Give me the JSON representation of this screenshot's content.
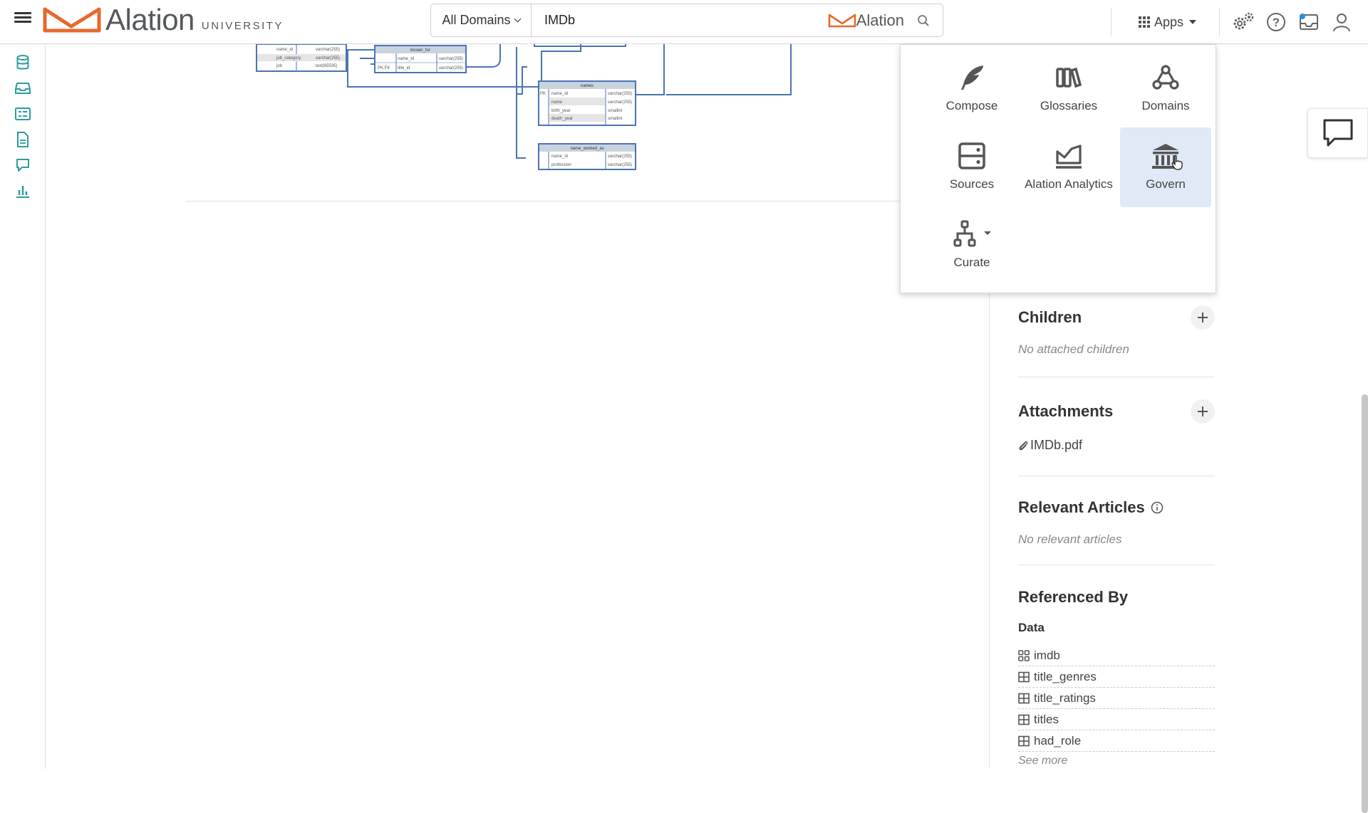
{
  "header": {
    "logo_text": "Alation",
    "logo_sub": "UNIVERSITY",
    "search_domain": "All Domains",
    "search_value": "IMDb",
    "search_brand": "Alation",
    "apps_label": "Apps"
  },
  "apps_menu": {
    "items": [
      {
        "label": "Compose",
        "icon": "quill-icon"
      },
      {
        "label": "Glossaries",
        "icon": "books-icon"
      },
      {
        "label": "Domains",
        "icon": "domains-icon"
      },
      {
        "label": "Sources",
        "icon": "server-icon"
      },
      {
        "label": "Alation Analytics",
        "icon": "analytics-icon"
      },
      {
        "label": "Govern",
        "icon": "bank-icon"
      },
      {
        "label": "Curate",
        "icon": "hierarchy-icon"
      }
    ],
    "active": "Govern"
  },
  "diagram": {
    "tables": [
      {
        "title": "",
        "rows": [
          [
            "",
            "name_id",
            "varchar(255)"
          ],
          [
            "",
            "job_category",
            "varchar(255)"
          ],
          [
            "",
            "job",
            "text(65535)"
          ]
        ]
      },
      {
        "title": "known_for",
        "rows": [
          [
            "",
            "name_id",
            "varchar(255)"
          ],
          [
            "PK,FK",
            "title_id",
            "varchar(255)"
          ]
        ]
      },
      {
        "title": "names",
        "rows": [
          [
            "PK",
            "name_id",
            "varchar(255)"
          ],
          [
            "",
            "name",
            "varchar(255)"
          ],
          [
            "",
            "birth_year",
            "smallint"
          ],
          [
            "",
            "death_year",
            "smallint"
          ]
        ]
      },
      {
        "title": "name_worked_as",
        "rows": [
          [
            "",
            "name_id",
            "varchar(255)"
          ],
          [
            "",
            "profession",
            "varchar(255)"
          ]
        ]
      }
    ]
  },
  "right_panel": {
    "children": {
      "title": "Children",
      "empty": "No attached children"
    },
    "attachments": {
      "title": "Attachments",
      "file": "IMDb.pdf"
    },
    "relevant": {
      "title": "Relevant Articles",
      "empty": "No relevant articles"
    },
    "referenced": {
      "title": "Referenced By",
      "subtitle": "Data",
      "items": [
        "imdb",
        "title_genres",
        "title_ratings",
        "titles",
        "had_role"
      ],
      "see_more": "See more"
    }
  },
  "colors": {
    "brand_orange": "#e8682c",
    "nav_teal": "#2a9d9c",
    "diagram_blue": "#4a73b5",
    "active_tile": "#dfeaf6"
  }
}
